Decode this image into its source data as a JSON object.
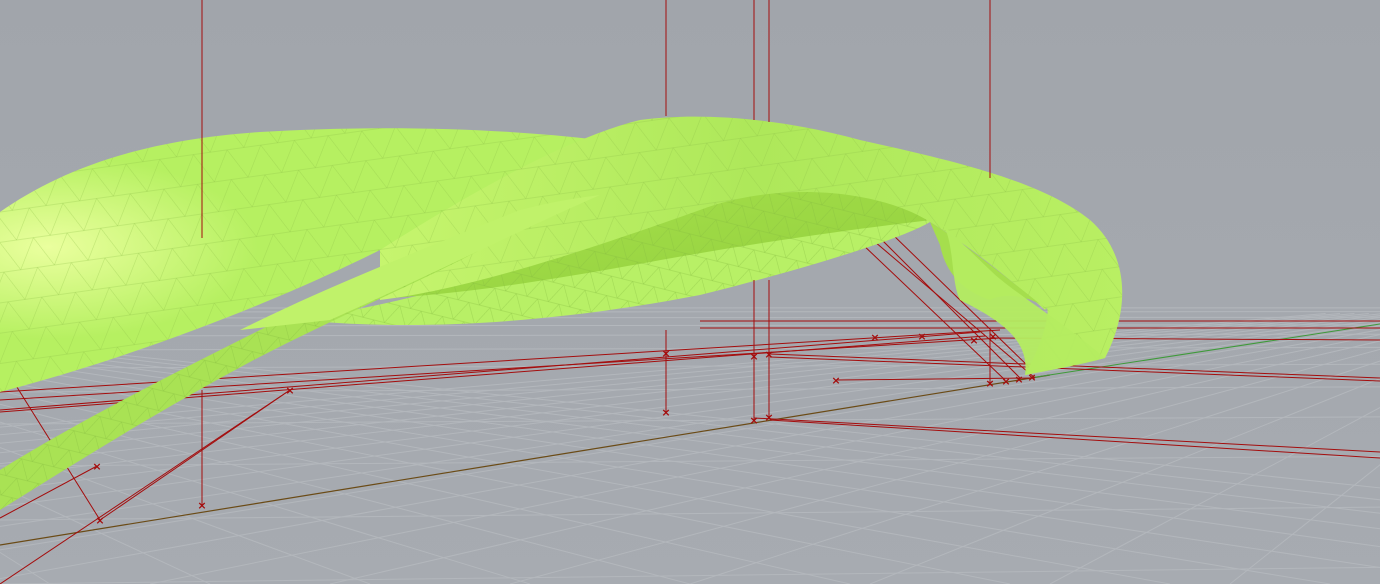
{
  "viewport": {
    "background_upper": "#a3a7ad",
    "background_lower": "#a6aab0",
    "grid_color": "#b4b8bd",
    "surface_color": "#b4f062",
    "surface_shadow": "#8fd43a",
    "surface_highlight": "#e6ff9a",
    "mesh_color": "#8cc544",
    "construction_color": "#a40d0d",
    "axis_x_color": "#6b4b16",
    "axis_y_color": "#3f9a3a"
  },
  "scene": {
    "mesh_surface": "mesh-surface",
    "construction_geometry": "construction-lines",
    "point_marker_glyph": "×"
  }
}
